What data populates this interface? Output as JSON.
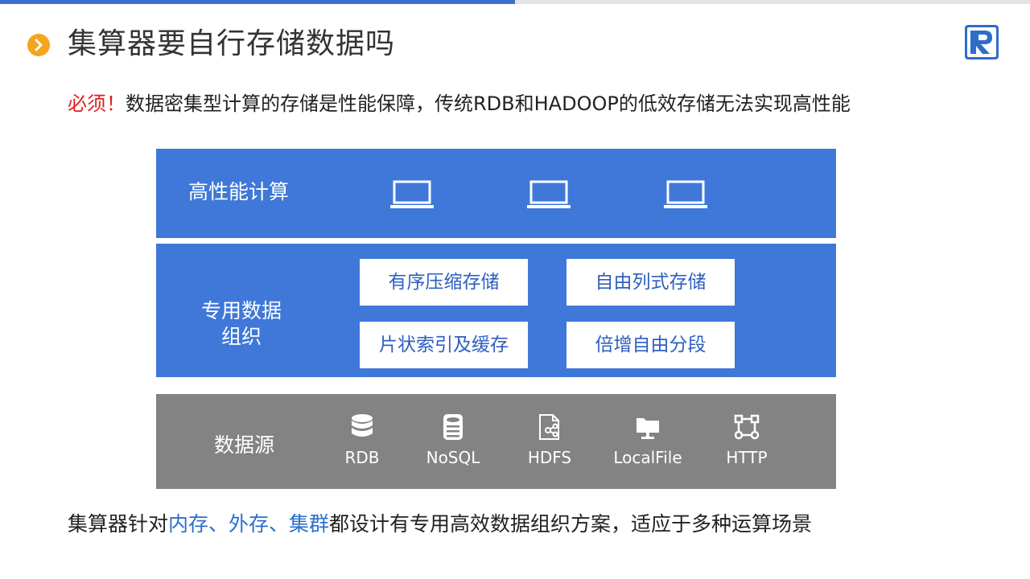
{
  "header": {
    "title": "集算器要自行存储数据吗",
    "bullet_icon": "chevron-right-icon",
    "logo_icon": "r-logo-icon",
    "accent_color": "#3a6fd0",
    "bullet_color": "#f3a51b"
  },
  "subtitle": {
    "emphasis": "必须！",
    "text": "数据密集型计算的存储是性能保障，传统RDB和HADOOP的低效存储无法实现高性能"
  },
  "diagram": {
    "compute": {
      "label": "高性能计算",
      "icons": [
        "laptop-icon",
        "laptop-icon",
        "laptop-icon"
      ]
    },
    "organization": {
      "label_line1": "专用数据",
      "label_line2": "组织",
      "boxes": [
        "有序压缩存储",
        "自由列式存储",
        "片状索引及缓存",
        "倍增自由分段"
      ]
    },
    "sources": {
      "label": "数据源",
      "items": [
        {
          "label": "RDB",
          "icon": "database-icon"
        },
        {
          "label": "NoSQL",
          "icon": "nosql-icon"
        },
        {
          "label": "HDFS",
          "icon": "hdfs-file-icon"
        },
        {
          "label": "LocalFile",
          "icon": "local-file-icon"
        },
        {
          "label": "HTTP",
          "icon": "http-network-icon"
        }
      ]
    }
  },
  "footer": {
    "part1": "集算器针对",
    "part2": "内存、外存、集群",
    "part3": "都设计有专用高效数据组织方案，适应于多种运算场景"
  }
}
